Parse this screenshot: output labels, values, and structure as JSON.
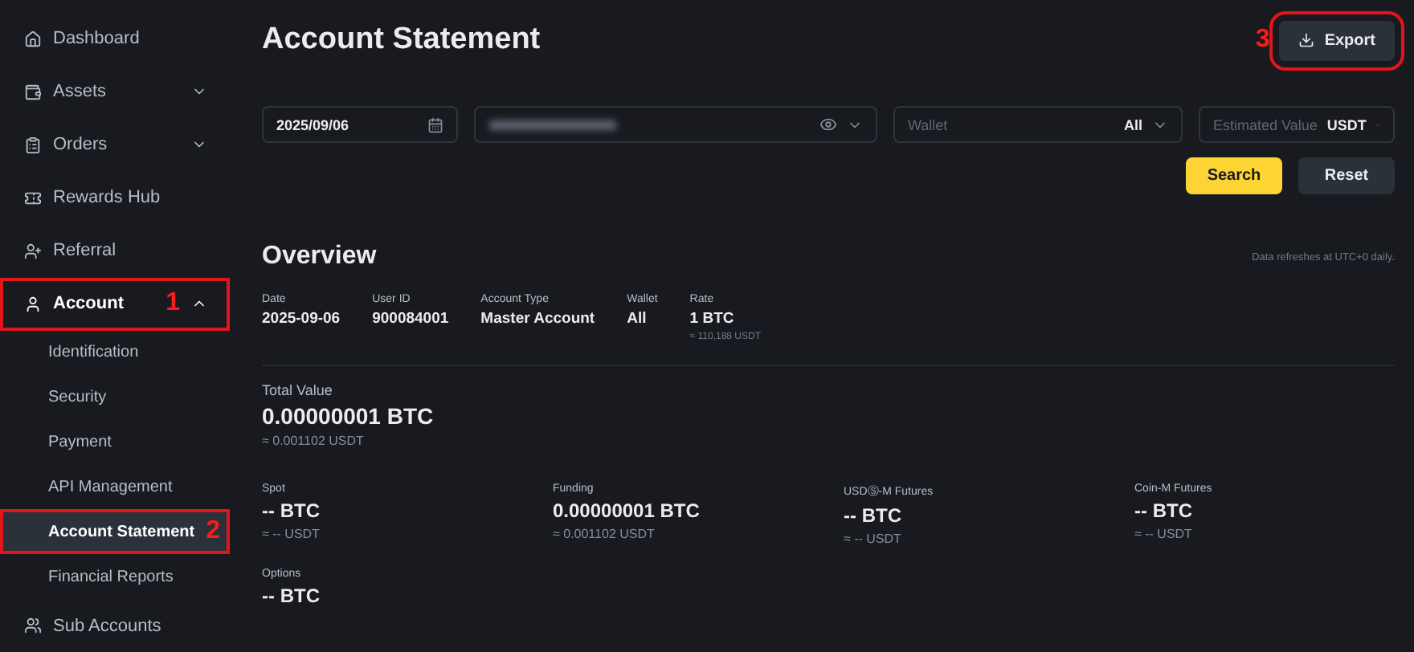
{
  "sidebar": {
    "items": [
      {
        "label": "Dashboard",
        "selected": false
      },
      {
        "label": "Assets",
        "expanded": false,
        "selected": false
      },
      {
        "label": "Orders",
        "expanded": false,
        "selected": false
      },
      {
        "label": "Rewards Hub",
        "selected": false
      },
      {
        "label": "Referral",
        "selected": false
      },
      {
        "label": "Account",
        "expanded": true,
        "selected": false,
        "annotation": "1",
        "children": [
          {
            "label": "Identification",
            "selected": false
          },
          {
            "label": "Security",
            "selected": false
          },
          {
            "label": "Payment",
            "selected": false
          },
          {
            "label": "API Management",
            "selected": false
          },
          {
            "label": "Account Statement",
            "selected": true,
            "annotation": "2"
          },
          {
            "label": "Financial Reports",
            "selected": false
          }
        ]
      },
      {
        "label": "Sub Accounts",
        "selected": false
      }
    ]
  },
  "header": {
    "title": "Account Statement",
    "export_button": {
      "label": "Export",
      "annotation": "3"
    }
  },
  "filters": {
    "date": "2025/09/06",
    "wallet": {
      "placeholder": "Wallet",
      "value": "All"
    },
    "estimated_value": {
      "placeholder": "Estimated Value",
      "value": "USDT"
    },
    "buttons": [
      "Search",
      "Reset"
    ]
  },
  "overview": {
    "title": "Overview",
    "note": "Data refreshes at UTC+0 daily.",
    "details": [
      {
        "label": "Date",
        "value": "2025-09-06"
      },
      {
        "label": "User ID",
        "value": "900084001"
      },
      {
        "label": "Account Type",
        "value": "Master Account"
      },
      {
        "label": "Wallet",
        "value": "All"
      },
      {
        "label": "Rate",
        "value": "1 BTC",
        "sub": "≈ 110,188 USDT"
      }
    ],
    "total": {
      "label": "Total Value",
      "value": "0.00000001 BTC",
      "sub": "≈ 0.001102 USDT"
    },
    "balances": [
      {
        "label": "Spot",
        "value": "-- BTC",
        "sub": "≈ -- USDT"
      },
      {
        "label": "Funding",
        "value": "0.00000001 BTC",
        "sub": "≈ 0.001102 USDT"
      },
      {
        "label": "USDⓈ-M Futures",
        "value": "-- BTC",
        "sub": "≈ -- USDT"
      },
      {
        "label": "Coin-M Futures",
        "value": "-- BTC",
        "sub": "≈ -- USDT"
      },
      {
        "label": "Options",
        "value": "-- BTC"
      }
    ]
  }
}
